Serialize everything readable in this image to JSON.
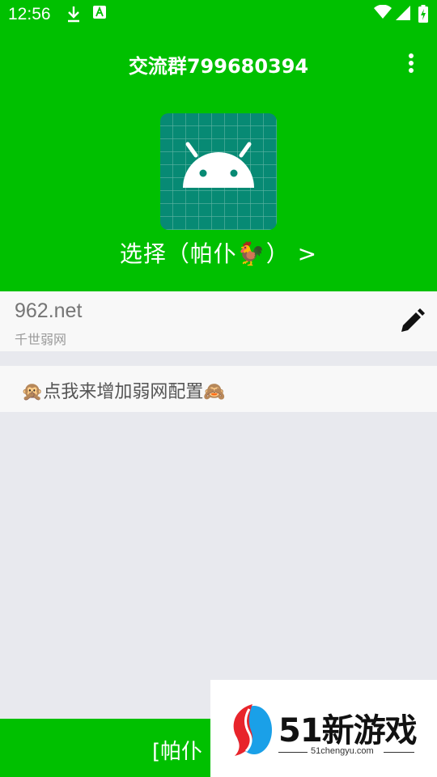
{
  "status_bar": {
    "time": "12:56",
    "icons": [
      "download-icon",
      "app-notification-icon",
      "wifi-icon",
      "signal-icon",
      "battery-charging-icon"
    ]
  },
  "app_bar": {
    "title": "交流群799680394",
    "overflow_icon": "more-vert-icon"
  },
  "header": {
    "app_icon": "android-icon",
    "select_label": "选择（帕仆🐓） >"
  },
  "config_item": {
    "name": "962.net",
    "subtitle": "千世弱网",
    "edit_icon": "pencil-icon"
  },
  "add_config": {
    "label": "🙊点我来增加弱网配置🙈"
  },
  "bottom_bar": {
    "label": "[帕仆"
  },
  "watermark": {
    "brand": "51新游戏",
    "domain": "51chengyu.com"
  },
  "colors": {
    "primary_green": "#00c000",
    "icon_teal": "#078a74",
    "background": "#e8e9ee"
  }
}
